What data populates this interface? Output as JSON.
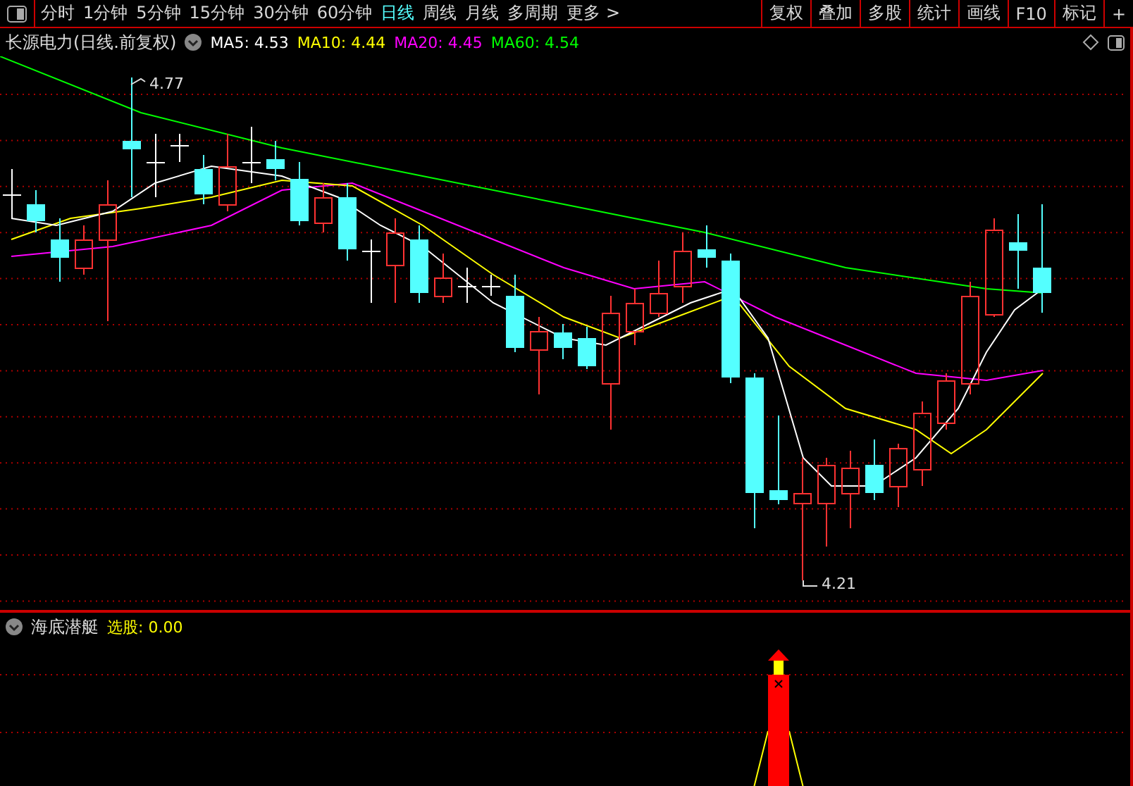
{
  "toolbar": {
    "periods": [
      {
        "label": "分时",
        "selected": false
      },
      {
        "label": "1分钟",
        "selected": false
      },
      {
        "label": "5分钟",
        "selected": false
      },
      {
        "label": "15分钟",
        "selected": false
      },
      {
        "label": "30分钟",
        "selected": false
      },
      {
        "label": "60分钟",
        "selected": false
      },
      {
        "label": "日线",
        "selected": true
      },
      {
        "label": "周线",
        "selected": false
      },
      {
        "label": "月线",
        "selected": false
      },
      {
        "label": "多周期",
        "selected": false
      }
    ],
    "more": "更多 >",
    "buttons": [
      "复权",
      "叠加",
      "多股",
      "统计",
      "画线",
      "F10",
      "标记",
      "+"
    ]
  },
  "main_chart": {
    "title": "长源电力(日线.前复权)",
    "averages": [
      {
        "label": "MA5: 4.53",
        "color": "#ffffff"
      },
      {
        "label": "MA10: 4.44",
        "color": "#ffff00"
      },
      {
        "label": "MA20: 4.45",
        "color": "#ff00ff"
      },
      {
        "label": "MA60: 4.54",
        "color": "#00ff00"
      }
    ],
    "high_label": "4.77",
    "low_label": "4.21"
  },
  "indicator_panel": {
    "name": "海底潜艇",
    "reading": "选股: 0.00"
  }
}
